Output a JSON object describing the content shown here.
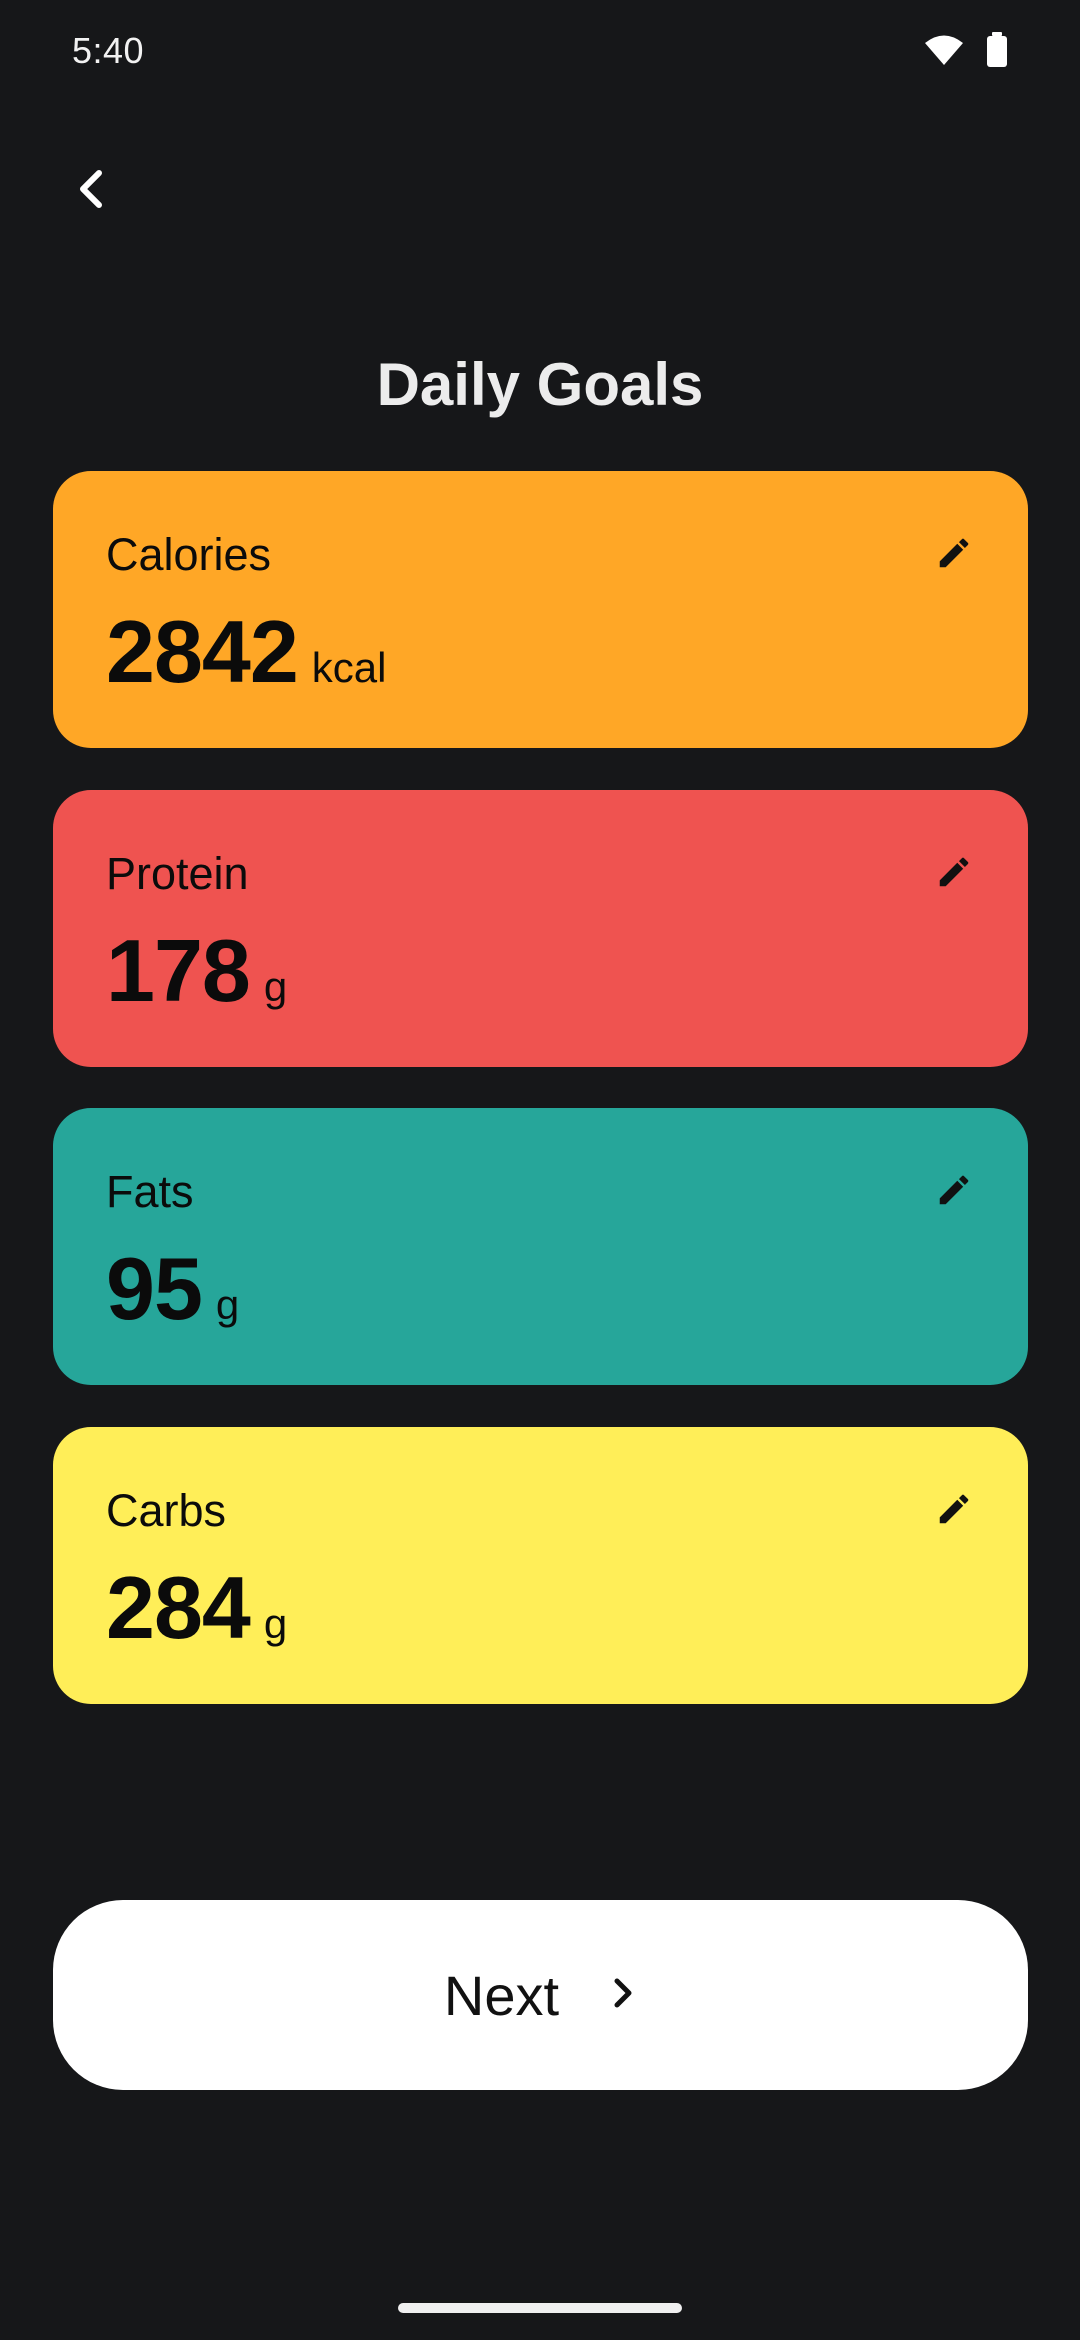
{
  "status_bar": {
    "time": "5:40",
    "wifi_icon": "wifi-icon",
    "battery_icon": "battery-icon"
  },
  "header": {
    "back_icon": "chevron-left-icon",
    "title": "Daily Goals"
  },
  "goals": [
    {
      "label": "Calories",
      "value": "2842",
      "unit": "kcal",
      "color": "#FFA726",
      "edit_icon": "pencil-icon"
    },
    {
      "label": "Protein",
      "value": "178",
      "unit": "g",
      "color": "#EF5350",
      "edit_icon": "pencil-icon"
    },
    {
      "label": "Fats",
      "value": "95",
      "unit": "g",
      "color": "#26A69A",
      "edit_icon": "pencil-icon"
    },
    {
      "label": "Carbs",
      "value": "284",
      "unit": "g",
      "color": "#FFEE58",
      "edit_icon": "pencil-icon"
    }
  ],
  "footer": {
    "next_label": "Next",
    "next_icon": "chevron-right-icon"
  },
  "colors": {
    "background": "#161719",
    "button_bg": "#FFFFFF"
  }
}
